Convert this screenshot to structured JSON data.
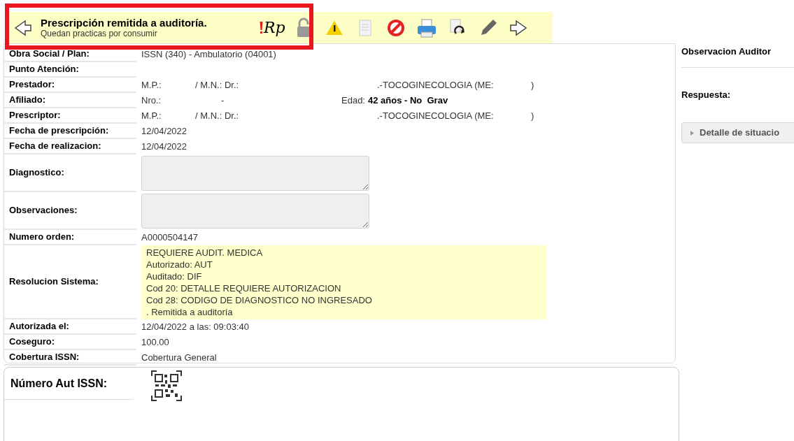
{
  "toolbar": {
    "title": "Prescripción remitida a auditoría.",
    "subtitle": "Quedan practicas por consumir",
    "rp_label": "Rp",
    "highlighted": true
  },
  "rows": [
    {
      "kind": "text",
      "label": "Obra Social / Plan:",
      "value": "ISSN (340) - Ambulatorio (04001)"
    },
    {
      "kind": "text",
      "label": "Punto Atención:",
      "value": ""
    },
    {
      "kind": "doctor",
      "label": "Prestador:",
      "parts": [
        "M.P.:",
        "/ M.N.: Dr.:",
        ".-TOCOGINECOLOGIA (ME:",
        ")"
      ]
    },
    {
      "kind": "affiliate",
      "label": "Afiliado:",
      "parts": [
        "Nro.:",
        "-",
        "Edad:",
        "42 años - No  Grav"
      ]
    },
    {
      "kind": "doctor",
      "label": "Prescriptor:",
      "parts": [
        "M.P.:",
        "/ M.N.: Dr.:",
        ".-TOCOGINECOLOGIA (ME:",
        ")"
      ]
    },
    {
      "kind": "text",
      "label": "Fecha de prescripción:",
      "value": "12/04/2022"
    },
    {
      "kind": "text",
      "label": "Fecha de realizacion:",
      "value": "12/04/2022"
    },
    {
      "kind": "textarea",
      "label": "Diagnostico:"
    },
    {
      "kind": "textarea",
      "label": "Observaciones:"
    },
    {
      "kind": "text",
      "label": "Numero orden:",
      "value": "A0000504147"
    },
    {
      "kind": "note",
      "label": "Resolucion Sistema:",
      "lines": [
        "REQUIERE AUDIT. MEDICA",
        "Autorizado: AUT",
        "Auditado: DIF",
        "Cod 20: DETALLE REQUIERE AUTORIZACION",
        "Cod 28: CODIGO DE DIAGNOSTICO NO INGRESADO",
        ". Remitida a auditoría"
      ]
    },
    {
      "kind": "text",
      "label": "Autorizada el:",
      "value": "12/04/2022 a las: 09:03:40"
    },
    {
      "kind": "text",
      "label": "Coseguro:",
      "value": "100.00"
    },
    {
      "kind": "text",
      "label": "Cobertura ISSN:",
      "value": "Cobertura General"
    }
  ],
  "side": {
    "observation_label": "Observacion Auditor",
    "answer_label": "Respuesta:",
    "detail_button": "Detalle de situacio",
    "detail_expanded": false
  },
  "footer": {
    "label": "Número Aut ISSN:"
  }
}
